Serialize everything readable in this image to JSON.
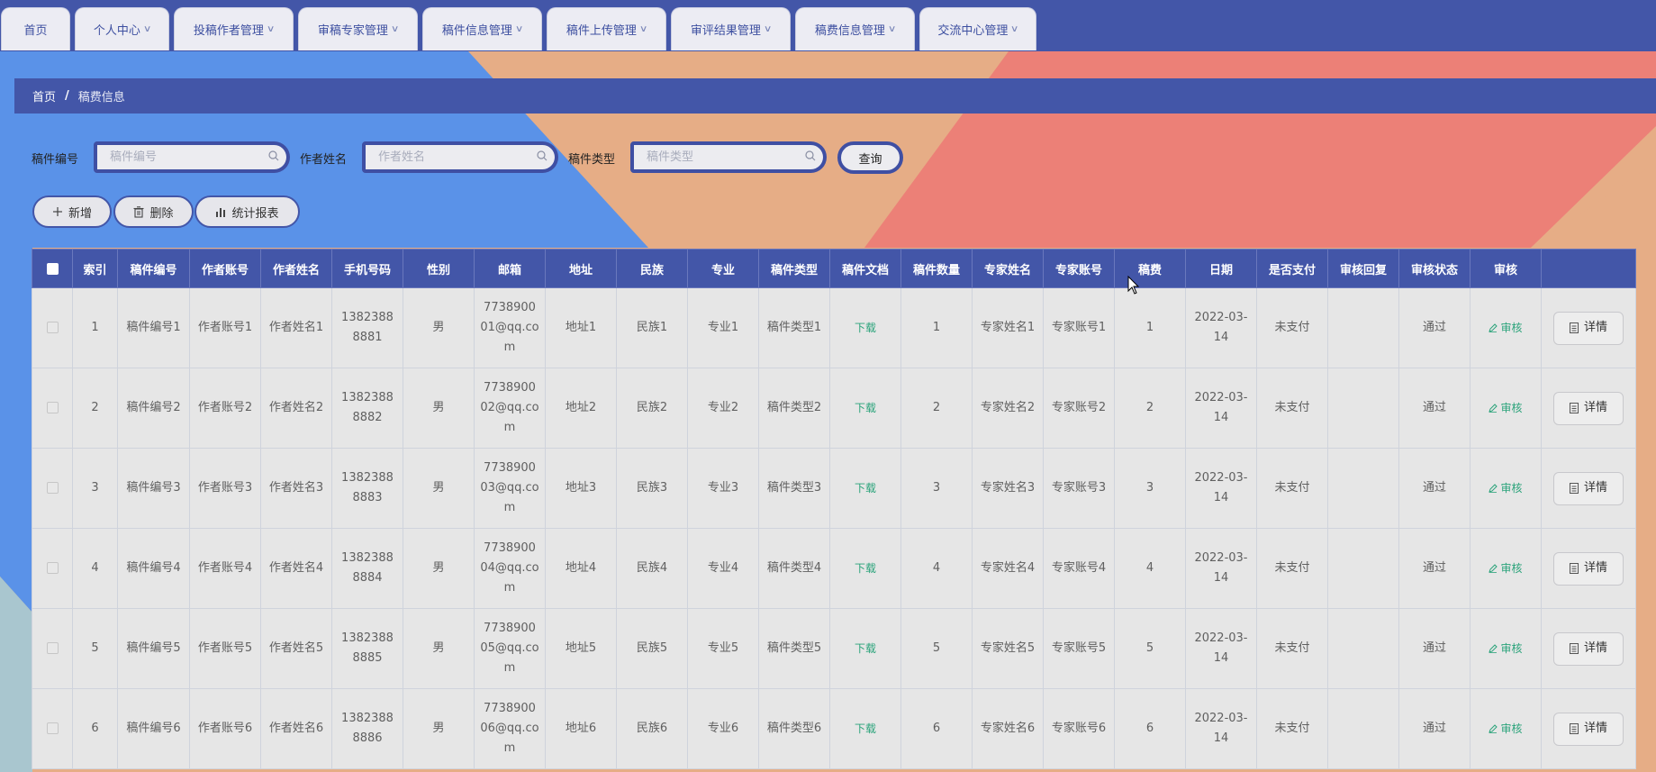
{
  "nav": {
    "tabs": [
      {
        "label": "首页",
        "has_menu": false
      },
      {
        "label": "个人中心",
        "has_menu": true
      },
      {
        "label": "投稿作者管理",
        "has_menu": true
      },
      {
        "label": "审稿专家管理",
        "has_menu": true
      },
      {
        "label": "稿件信息管理",
        "has_menu": true
      },
      {
        "label": "稿件上传管理",
        "has_menu": true
      },
      {
        "label": "审评结果管理",
        "has_menu": true
      },
      {
        "label": "稿费信息管理",
        "has_menu": true
      },
      {
        "label": "交流中心管理",
        "has_menu": true
      }
    ]
  },
  "breadcrumb": {
    "home": "首页",
    "separator": "/",
    "current": "稿费信息"
  },
  "search": {
    "fields": [
      {
        "label": "稿件编号",
        "placeholder": "稿件编号",
        "value": ""
      },
      {
        "label": "作者姓名",
        "placeholder": "作者姓名",
        "value": ""
      },
      {
        "label": "稿件类型",
        "placeholder": "稿件类型",
        "value": ""
      }
    ],
    "query_label": "查询"
  },
  "actions": {
    "add": "新增",
    "delete": "删除",
    "report": "统计报表"
  },
  "table": {
    "columns": [
      "索引",
      "稿件编号",
      "作者账号",
      "作者姓名",
      "手机号码",
      "性别",
      "邮箱",
      "地址",
      "民族",
      "专业",
      "稿件类型",
      "稿件文档",
      "稿件数量",
      "专家姓名",
      "专家账号",
      "稿费",
      "日期",
      "是否支付",
      "审核回复",
      "审核状态",
      "审核"
    ],
    "download_label": "下载",
    "audit_label": "审核",
    "detail_label": "详情",
    "rows": [
      {
        "index": "1",
        "code": "稿件编号1",
        "account": "作者账号1",
        "name": "作者姓名1",
        "phone": "13823888881",
        "gender": "男",
        "email": "773890001@qq.com",
        "address": "地址1",
        "nation": "民族1",
        "major": "专业1",
        "type": "稿件类型1",
        "count": "1",
        "expert_name": "专家姓名1",
        "expert_account": "专家账号1",
        "fee": "1",
        "date": "2022-03-14",
        "paid": "未支付",
        "reply": "",
        "status": "通过"
      },
      {
        "index": "2",
        "code": "稿件编号2",
        "account": "作者账号2",
        "name": "作者姓名2",
        "phone": "13823888882",
        "gender": "男",
        "email": "773890002@qq.com",
        "address": "地址2",
        "nation": "民族2",
        "major": "专业2",
        "type": "稿件类型2",
        "count": "2",
        "expert_name": "专家姓名2",
        "expert_account": "专家账号2",
        "fee": "2",
        "date": "2022-03-14",
        "paid": "未支付",
        "reply": "",
        "status": "通过"
      },
      {
        "index": "3",
        "code": "稿件编号3",
        "account": "作者账号3",
        "name": "作者姓名3",
        "phone": "13823888883",
        "gender": "男",
        "email": "773890003@qq.com",
        "address": "地址3",
        "nation": "民族3",
        "major": "专业3",
        "type": "稿件类型3",
        "count": "3",
        "expert_name": "专家姓名3",
        "expert_account": "专家账号3",
        "fee": "3",
        "date": "2022-03-14",
        "paid": "未支付",
        "reply": "",
        "status": "通过"
      },
      {
        "index": "4",
        "code": "稿件编号4",
        "account": "作者账号4",
        "name": "作者姓名4",
        "phone": "13823888884",
        "gender": "男",
        "email": "773890004@qq.com",
        "address": "地址4",
        "nation": "民族4",
        "major": "专业4",
        "type": "稿件类型4",
        "count": "4",
        "expert_name": "专家姓名4",
        "expert_account": "专家账号4",
        "fee": "4",
        "date": "2022-03-14",
        "paid": "未支付",
        "reply": "",
        "status": "通过"
      },
      {
        "index": "5",
        "code": "稿件编号5",
        "account": "作者账号5",
        "name": "作者姓名5",
        "phone": "13823888885",
        "gender": "男",
        "email": "773890005@qq.com",
        "address": "地址5",
        "nation": "民族5",
        "major": "专业5",
        "type": "稿件类型5",
        "count": "5",
        "expert_name": "专家姓名5",
        "expert_account": "专家账号5",
        "fee": "5",
        "date": "2022-03-14",
        "paid": "未支付",
        "reply": "",
        "status": "通过"
      },
      {
        "index": "6",
        "code": "稿件编号6",
        "account": "作者账号6",
        "name": "作者姓名6",
        "phone": "13823888886",
        "gender": "男",
        "email": "773890006@qq.com",
        "address": "地址6",
        "nation": "民族6",
        "major": "专业6",
        "type": "稿件类型6",
        "count": "6",
        "expert_name": "专家姓名6",
        "expert_account": "专家账号6",
        "fee": "6",
        "date": "2022-03-14",
        "paid": "未支付",
        "reply": "",
        "status": "通过"
      }
    ]
  },
  "colors": {
    "primary": "#4356a8",
    "bg_blue": "#5a92e8",
    "bg_peach": "#e6ad86",
    "bg_coral": "#ec8077",
    "bg_teal": "#a9c6cf",
    "link_green": "#2aa37a"
  },
  "icons": {
    "search": "magnifier-icon",
    "add": "plus-icon",
    "delete": "trash-icon",
    "report": "bar-chart-icon",
    "audit": "pencil-icon",
    "detail": "document-icon",
    "dropdown": "chevron-down-icon"
  }
}
